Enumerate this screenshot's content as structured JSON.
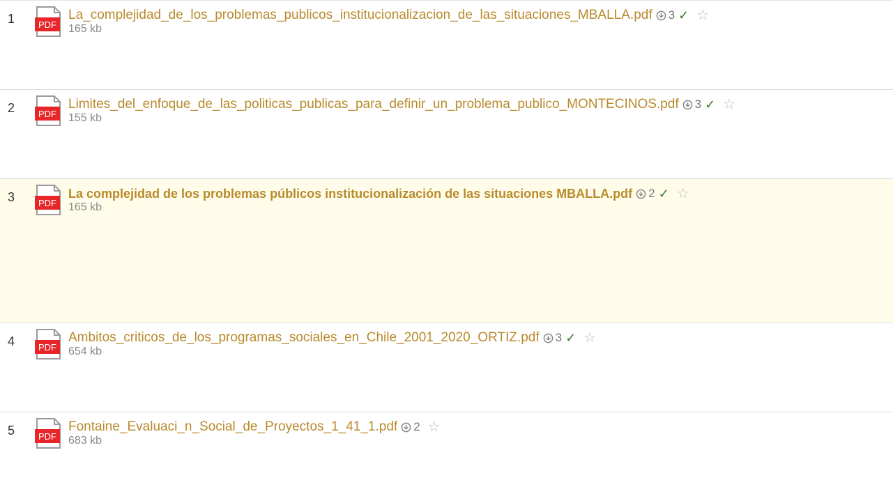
{
  "files": [
    {
      "index": "1",
      "icon": "pdf-file-icon",
      "icon_label": "PDF",
      "name": "La_complejidad_de_los_problemas_publicos_institucionalizacion_de_las_situaciones_MBALLA.pdf",
      "downloads": "3",
      "check": "✓",
      "star": "☆",
      "size": "165 kb",
      "highlighted": false
    },
    {
      "index": "2",
      "icon": "pdf-file-icon",
      "icon_label": "PDF",
      "name": "Limites_del_enfoque_de_las_politicas_publicas_para_definir_un_problema_publico_MONTECINOS.pdf",
      "downloads": "3",
      "check": "✓",
      "star": "☆",
      "size": "155 kb",
      "highlighted": false
    },
    {
      "index": "3",
      "icon": "pdf-file-icon",
      "icon_label": "PDF",
      "name": "La complejidad de los problemas públicos institucionalización de las situaciones MBALLA.pdf",
      "downloads": "2",
      "check": "✓",
      "star": "☆",
      "size": "165 kb",
      "highlighted": true
    },
    {
      "index": "4",
      "icon": "pdf-file-icon",
      "icon_label": "PDF",
      "name": "Ambitos_criticos_de_los_programas_sociales_en_Chile_2001_2020_ORTIZ.pdf",
      "downloads": "3",
      "check": "✓",
      "star": "☆",
      "size": "654 kb",
      "highlighted": false
    },
    {
      "index": "5",
      "icon": "pdf-file-icon",
      "icon_label": "PDF",
      "name": "Fontaine_Evaluaci_n_Social_de_Proyectos_1_41_1.pdf",
      "downloads": "2",
      "check": "",
      "star": "☆",
      "size": "683 kb",
      "highlighted": false
    }
  ],
  "colors": {
    "link": "#b88a2c",
    "highlight_bg": "#fffdea",
    "pdf_red": "#e8262a",
    "check_green": "#3c7a2a"
  }
}
